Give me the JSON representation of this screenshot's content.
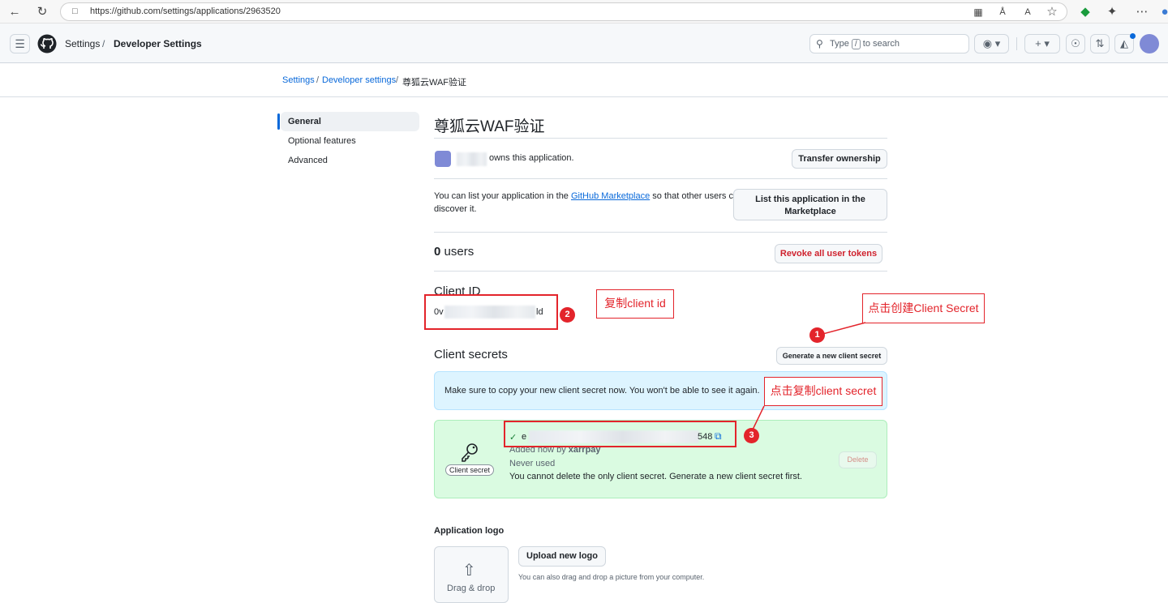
{
  "browser": {
    "url": "https://github.com/settings/applications/2963520"
  },
  "header": {
    "crumb_settings": "Settings",
    "crumb_sep": "/",
    "crumb_developer": "Developer Settings",
    "search_prefix": "Type",
    "search_key": "/",
    "search_suffix": "to search"
  },
  "subheader": {
    "crumbs": [
      "Settings",
      "Developer settings",
      "尊狐云WAF验证"
    ],
    "sep": "/"
  },
  "sidebar": {
    "items": [
      {
        "label": "General",
        "active": true
      },
      {
        "label": "Optional features"
      },
      {
        "label": "Advanced"
      }
    ]
  },
  "app": {
    "title": "尊狐云WAF验证",
    "owner_text": "owns this application.",
    "transfer_button": "Transfer ownership",
    "marketplace_text_1": "You can list your application in the",
    "marketplace_link": "GitHub Marketplace",
    "marketplace_text_2": "so that other users can",
    "marketplace_text_3": "discover it.",
    "marketplace_button": "List this application in the Marketplace",
    "users_count": "0",
    "users_label": "users",
    "revoke_button": "Revoke all user tokens",
    "client_id_heading": "Client ID",
    "client_id_start": "0v",
    "client_id_end": "ld",
    "client_secrets_heading": "Client secrets",
    "generate_button": "Generate a new client secret",
    "flash_message": "Make sure to copy your new client secret now. You won't be able to see it again.",
    "secret_start": "e",
    "secret_end": "548",
    "secret_added_prefix": "Added now by",
    "secret_added_user": "xarrpay",
    "secret_never_used": "Never used",
    "secret_warning": "You cannot delete the only client secret. Generate a new client secret first.",
    "secret_icon_label": "Client secret",
    "delete_button": "Delete",
    "logo_heading": "Application logo",
    "upload_button": "Upload new logo",
    "upload_hint": "You can also drag and drop a picture from your computer.",
    "drag_drop": "Drag & drop"
  },
  "annotations": {
    "label_copy_id": "复制client id",
    "label_create_secret": "点击创建Client Secret",
    "label_copy_secret": "点击复制client secret",
    "num_1": "1",
    "num_2": "2",
    "num_3": "3",
    "color": "#e3242b"
  },
  "colors": {
    "link": "#0969da",
    "danger": "#cf222e",
    "flash_bg": "#ddf4ff",
    "success_bg": "#dafbe1"
  }
}
